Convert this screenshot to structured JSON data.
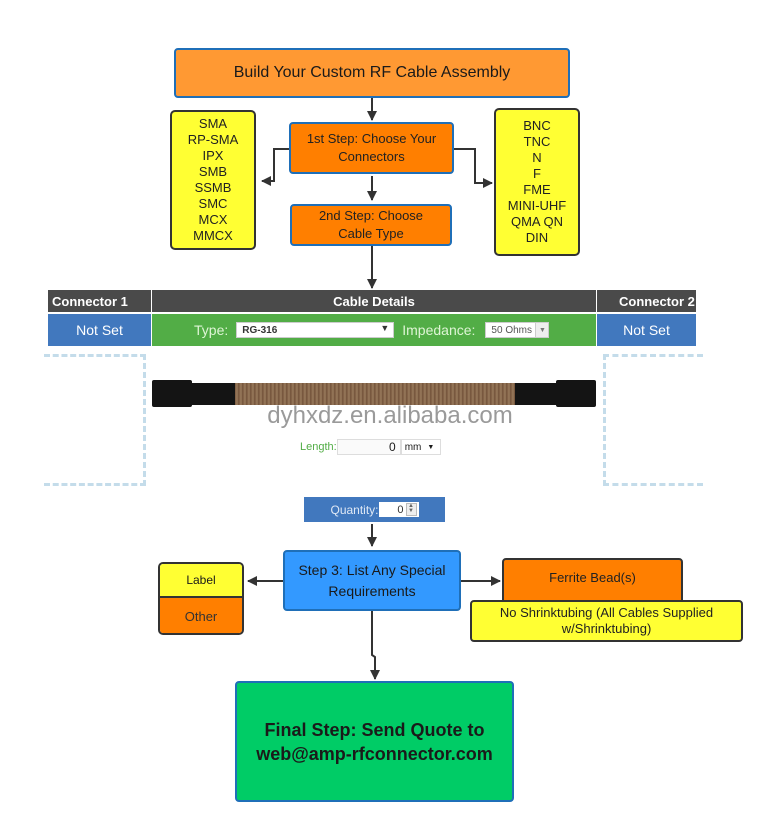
{
  "title": "Build Your Custom RF Cable Assembly",
  "step1": {
    "label": "1st Step: Choose Your Connectors",
    "left_connectors": [
      "SMA",
      "RP-SMA",
      "IPX",
      "SMB",
      "SSMB",
      "SMC",
      "MCX",
      "MMCX"
    ],
    "right_connectors": [
      "BNC",
      "TNC",
      "N",
      "F",
      "FME",
      "MINI-UHF",
      "QMA QN",
      "DIN"
    ]
  },
  "step2": {
    "label": "2nd Step: Choose Cable Type"
  },
  "builder": {
    "connector1_header": "Connector 1",
    "cable_details_header": "Cable Details",
    "connector2_header": "Connector 2",
    "connector1_value": "Not Set",
    "connector2_value": "Not Set",
    "type_label": "Type:",
    "type_value": "RG-316",
    "impedance_label": "Impedance:",
    "impedance_value": "50 Ohms",
    "watermark": "dyhxdz.en.alibaba.com",
    "length_label": "Length:",
    "length_value": "0",
    "length_unit": "mm",
    "quantity_label": "Quantity:",
    "quantity_value": "0"
  },
  "step3": {
    "label": "Step 3: List Any Special Requirements",
    "left_options": [
      "Label",
      "Other"
    ],
    "right_options": [
      "Ferrite Bead(s)",
      "No Shrinktubing (All Cables Supplied w/Shrinktubing)"
    ]
  },
  "final": {
    "line1": "Final Step: Send Quote to",
    "line2": "web@amp-rfconnector.com"
  },
  "colors": {
    "title_orange": "#ff9933",
    "step_orange": "#ff7f00",
    "list_yellow": "#ffff33",
    "step3_blue": "#3399ff",
    "final_green": "#00cc66",
    "header_dark": "#4a4a4a",
    "notset_blue": "#4178be",
    "cable_green": "#52ad46"
  }
}
